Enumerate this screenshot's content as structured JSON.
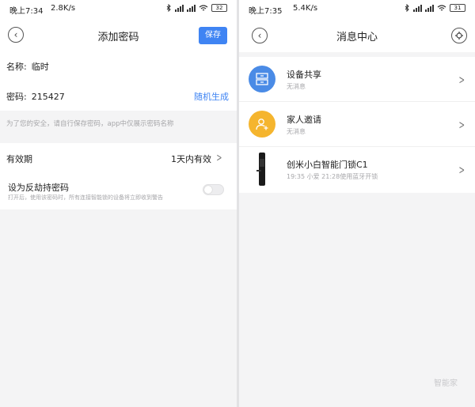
{
  "left_screen": {
    "status": {
      "time": "晚上7:34",
      "speed": "2.8K/s",
      "battery": "32"
    },
    "nav": {
      "title": "添加密码",
      "save_label": "保存"
    },
    "form": {
      "name_label": "名称:",
      "name_value": "临时",
      "password_label": "密码:",
      "password_value": "215427",
      "random_label": "随机生成"
    },
    "hint": "为了您的安全，请自行保存密码，app中仅展示密码名称",
    "validity": {
      "label": "有效期",
      "value": "1天内有效"
    },
    "duress": {
      "title": "设为反劫持密码",
      "description": "打开后，使用该密码时，所有连接智能锁的设备将立即收到警告",
      "enabled": false
    }
  },
  "right_screen": {
    "status": {
      "time": "晚上7:35",
      "speed": "5.4K/s",
      "battery": "31"
    },
    "nav": {
      "title": "消息中心"
    },
    "messages": [
      {
        "title": "设备共享",
        "subtitle": "无消息",
        "icon": "device-share-icon",
        "color": "#4a8be6"
      },
      {
        "title": "家人邀请",
        "subtitle": "无消息",
        "icon": "family-invite-icon",
        "color": "#f5b52e"
      },
      {
        "title": "创米小白智能门锁C1",
        "subtitle": "19:35 小爱 21:28使用蓝牙开锁",
        "icon": "door-lock-icon"
      }
    ]
  },
  "colors": {
    "accent": "#3f84f3",
    "share": "#4a8be6",
    "invite": "#f5b52e"
  },
  "watermark": "智能家"
}
